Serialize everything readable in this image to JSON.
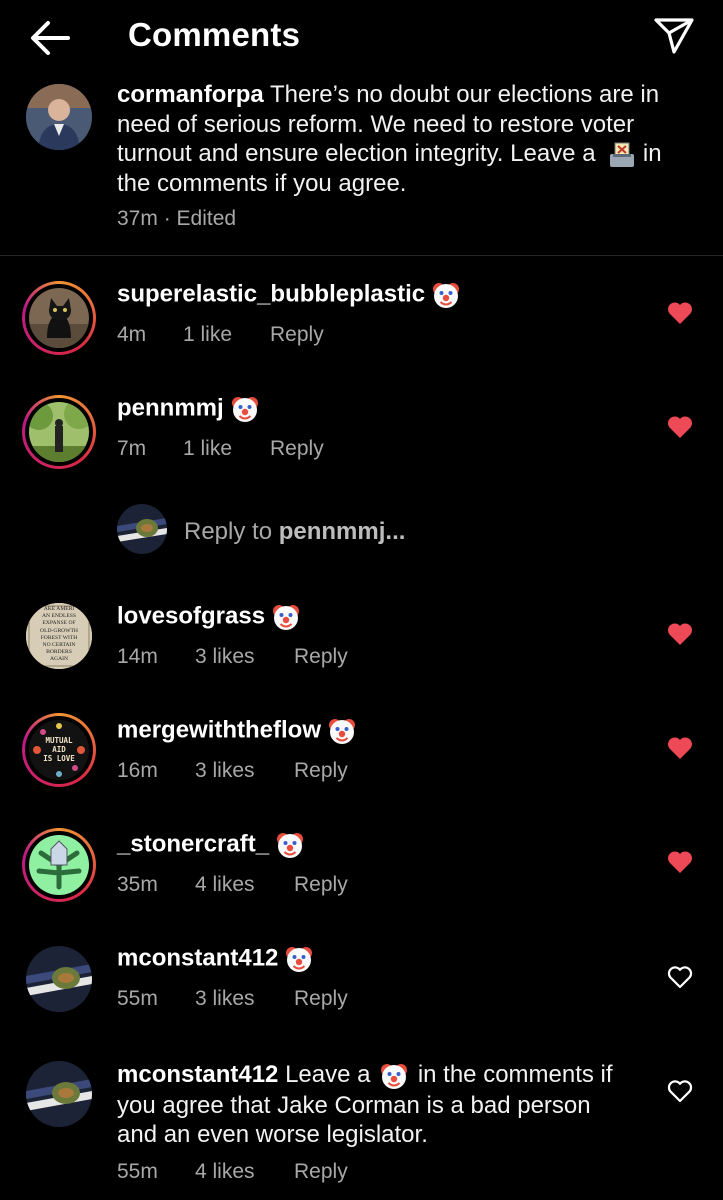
{
  "header": {
    "title": "Comments"
  },
  "caption": {
    "username": "cormanforpa",
    "text_before_emoji": "There’s no doubt our elections are in need of serious reform. We need to restore voter turnout and ensure election integrity. Leave a",
    "text_after_emoji": "in the comments if you agree.",
    "time": "37m",
    "separator": "·",
    "edited": "Edited"
  },
  "comments": [
    {
      "username": "superelastic_bubbleplastic",
      "time": "4m",
      "likes": "1 like",
      "reply": "Reply",
      "liked": true
    },
    {
      "username": "pennmmj",
      "time": "7m",
      "likes": "1 like",
      "reply": "Reply",
      "liked": true
    },
    {
      "username": "lovesofgrass",
      "time": "14m",
      "likes": "3 likes",
      "reply": "Reply",
      "liked": true
    },
    {
      "username": "mergewiththeflow",
      "time": "16m",
      "likes": "3 likes",
      "reply": "Reply",
      "liked": true
    },
    {
      "username": "_stonercraft_",
      "time": "35m",
      "likes": "4 likes",
      "reply": "Reply",
      "liked": true
    },
    {
      "username": "mconstant412",
      "time": "55m",
      "likes": "3 likes",
      "reply": "Reply",
      "liked": false
    },
    {
      "username": "mconstant412",
      "text_before_emoji": "Leave a",
      "text_after_emoji": "in the comments if you agree that Jake Corman is a bad person and an even worse legislator.",
      "time": "55m",
      "likes": "4 likes",
      "reply": "Reply",
      "liked": false
    }
  ],
  "reply_input": {
    "prefix": "Reply to",
    "target": "pennmmj..."
  },
  "avatar_art": {
    "lovesofgrass": [
      "AKE AMERI",
      "AN ENDLESS",
      "EXPANSE OF",
      "OLD-GROWTH",
      "FOREST WITH",
      "NO CERTAIN",
      "BORDERS",
      "AGAIN"
    ],
    "mergewiththeflow": [
      "MUTUAL",
      "AID",
      "IS LOVE"
    ]
  },
  "colors": {
    "background": "#000000",
    "text": "#ffffff",
    "muted": "#a8a8a8",
    "heart_liked": "#ed4956",
    "story_ring": "#dc2743"
  },
  "icons": [
    "back-arrow-icon",
    "send-icon",
    "clown-face-icon",
    "ballot-box-icon",
    "heart-icon"
  ]
}
